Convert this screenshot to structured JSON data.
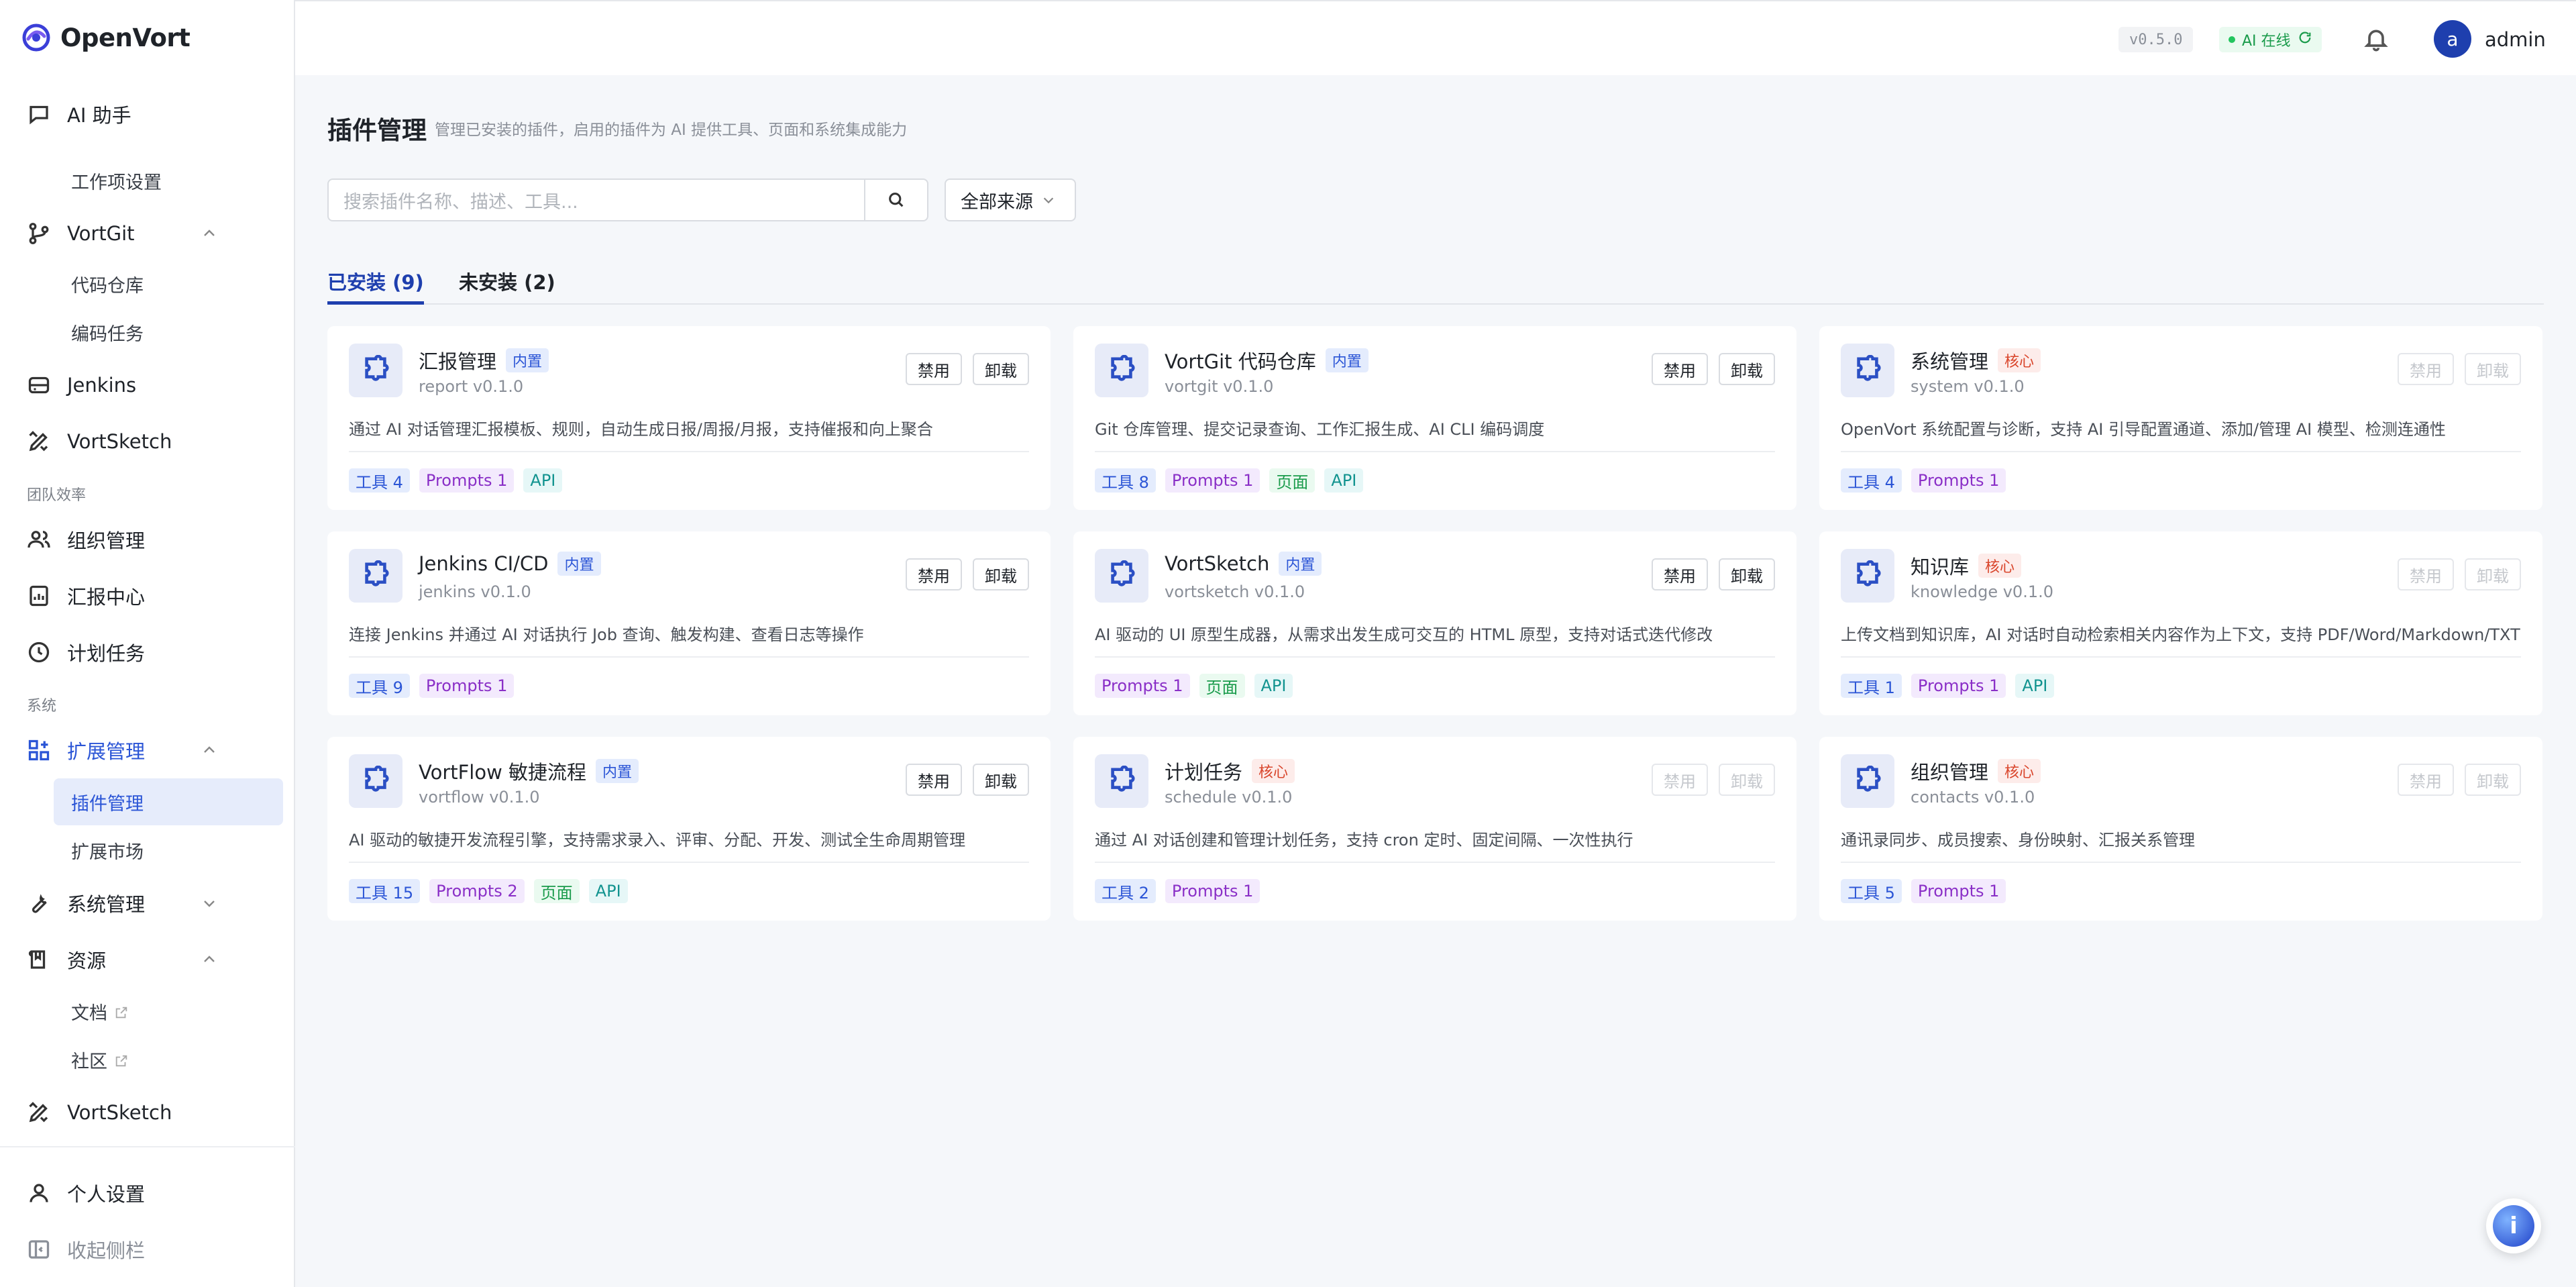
{
  "brand": {
    "name": "OpenVort"
  },
  "sidebar": {
    "ai_assistant": "AI 助手",
    "work_settings": "工作项设置",
    "vortgit": "VortGit",
    "code_repo": "代码仓库",
    "coding_tasks": "编码任务",
    "jenkins": "Jenkins",
    "vortsketch": "VortSketch",
    "section_team": "团队效率",
    "org_mgmt": "组织管理",
    "report_center": "汇报中心",
    "plan_tasks": "计划任务",
    "section_system": "系统",
    "ext_mgmt": "扩展管理",
    "plugin_mgmt": "插件管理",
    "ext_market": "扩展市场",
    "sys_mgmt": "系统管理",
    "resources": "资源",
    "docs": "文档",
    "community": "社区",
    "vortsketch2": "VortSketch",
    "personal_settings": "个人设置",
    "collapse": "收起侧栏"
  },
  "topbar": {
    "version": "v0.5.0",
    "ai_status": "AI 在线",
    "avatar_letter": "a",
    "username": "admin"
  },
  "page": {
    "title": "插件管理",
    "subtitle": "管理已安装的插件，启用的插件为 AI 提供工具、页面和系统集成能力",
    "search_placeholder": "搜索插件名称、描述、工具...",
    "source_filter": "全部来源",
    "tab_installed": "已安装 (9)",
    "tab_not_installed": "未安装 (2)"
  },
  "buttons": {
    "disable": "禁用",
    "uninstall": "卸载"
  },
  "badges": {
    "builtin": "内置",
    "core": "核心"
  },
  "plugins": [
    {
      "name": "汇报管理",
      "badge": "内置",
      "version": "report v0.1.0",
      "desc": "通过 AI 对话管理汇报模板、规则，自动生成日报/周报/月报，支持催报和向上聚合",
      "tags": [
        "工具 4",
        "Prompts 1",
        "API"
      ]
    },
    {
      "name": "VortGit 代码仓库",
      "badge": "内置",
      "version": "vortgit v0.1.0",
      "desc": "Git 仓库管理、提交记录查询、工作汇报生成、AI CLI 编码调度",
      "tags": [
        "工具 8",
        "Prompts 1",
        "页面",
        "API"
      ]
    },
    {
      "name": "系统管理",
      "badge": "核心",
      "version": "system v0.1.0",
      "desc": "OpenVort 系统配置与诊断，支持 AI 引导配置通道、添加/管理 AI 模型、检测连通性",
      "tags": [
        "工具 4",
        "Prompts 1"
      ]
    },
    {
      "name": "Jenkins CI/CD",
      "badge": "内置",
      "version": "jenkins v0.1.0",
      "desc": "连接 Jenkins 并通过 AI 对话执行 Job 查询、触发构建、查看日志等操作",
      "tags": [
        "工具 9",
        "Prompts 1"
      ]
    },
    {
      "name": "VortSketch",
      "badge": "内置",
      "version": "vortsketch v0.1.0",
      "desc": "AI 驱动的 UI 原型生成器，从需求出发生成可交互的 HTML 原型，支持对话式迭代修改",
      "tags": [
        "Prompts 1",
        "页面",
        "API"
      ]
    },
    {
      "name": "知识库",
      "badge": "核心",
      "version": "knowledge v0.1.0",
      "desc": "上传文档到知识库，AI 对话时自动检索相关内容作为上下文，支持 PDF/Word/Markdown/TXT",
      "tags": [
        "工具 1",
        "Prompts 1",
        "API"
      ]
    },
    {
      "name": "VortFlow 敏捷流程",
      "badge": "内置",
      "version": "vortflow v0.1.0",
      "desc": "AI 驱动的敏捷开发流程引擎，支持需求录入、评审、分配、开发、测试全生命周期管理",
      "tags": [
        "工具 15",
        "Prompts 2",
        "页面",
        "API"
      ]
    },
    {
      "name": "计划任务",
      "badge": "核心",
      "version": "schedule v0.1.0",
      "desc": "通过 AI 对话创建和管理计划任务，支持 cron 定时、固定间隔、一次性执行",
      "tags": [
        "工具 2",
        "Prompts 1"
      ]
    },
    {
      "name": "组织管理",
      "badge": "核心",
      "version": "contacts v0.1.0",
      "desc": "通讯录同步、成员搜索、身份映射、汇报关系管理",
      "tags": [
        "工具 5",
        "Prompts 1"
      ]
    }
  ]
}
